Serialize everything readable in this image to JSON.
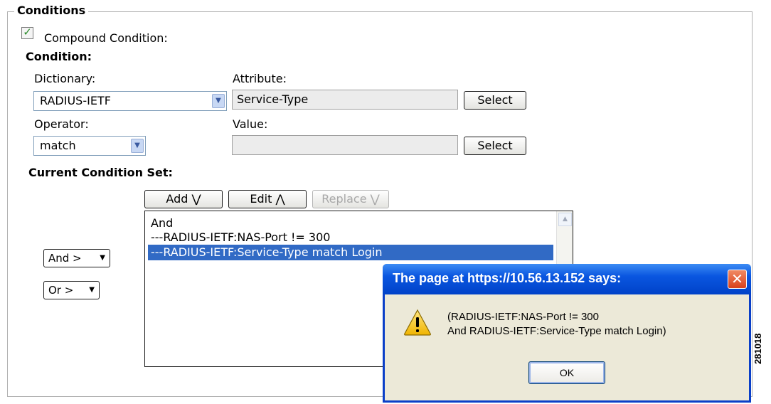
{
  "section_title": "Conditions",
  "compound_condition": {
    "label": "Compound Condition:",
    "checked": true
  },
  "condition_heading": "Condition:",
  "dictionary": {
    "label": "Dictionary:",
    "value": "RADIUS-IETF"
  },
  "attribute": {
    "label": "Attribute:",
    "value": "Service-Type",
    "select_label": "Select"
  },
  "operator": {
    "label": "Operator:",
    "value": "match"
  },
  "value_field": {
    "label": "Value:",
    "value": "",
    "select_label": "Select"
  },
  "current_condition_set": {
    "heading": "Current Condition Set:",
    "buttons": {
      "add": "Add ⋁",
      "edit": "Edit ⋀",
      "replace": "Replace ⋁"
    },
    "items": [
      {
        "text": "And",
        "selected": false
      },
      {
        "text": "---RADIUS-IETF:NAS-Port != 300",
        "selected": false
      },
      {
        "text": "---RADIUS-IETF:Service-Type match Login",
        "selected": true
      }
    ],
    "and_select": "And >",
    "or_select": "Or >"
  },
  "dialog": {
    "title": "The page at https://10.56.13.152 says:",
    "message_line1": "(RADIUS-IETF:NAS-Port != 300",
    "message_line2": "And RADIUS-IETF:Service-Type match Login)",
    "ok_label": "OK"
  },
  "figure_id": "281018",
  "colors": {
    "selection": "#316ac5",
    "dialog_title": "#0a56e0",
    "dialog_bg": "#ece9d8",
    "check": "#2a8a2a"
  }
}
